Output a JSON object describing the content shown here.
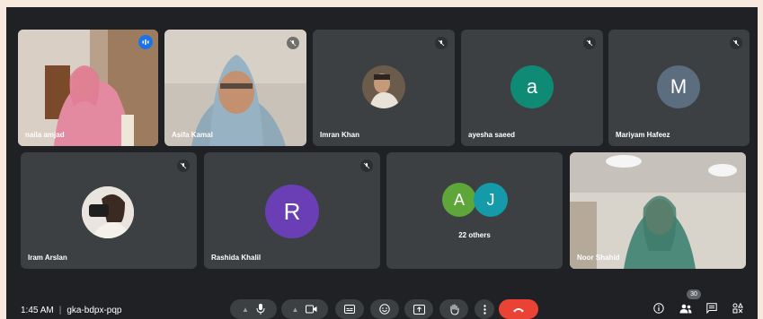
{
  "participants": [
    {
      "name": "naila amjad",
      "speaking": true
    },
    {
      "name": "Asifa Kamal"
    },
    {
      "name": "Imran Khan"
    },
    {
      "name": "ayesha saeed",
      "initial": "a",
      "color": "#0f8a74"
    },
    {
      "name": "Mariyam Hafeez",
      "initial": "M",
      "color": "#5b6d7e"
    },
    {
      "name": "Iram Arslan"
    },
    {
      "name": "Rashida Khalil",
      "initial": "R",
      "color": "#6a3fb6"
    },
    {
      "name": "Noor Shahid"
    }
  ],
  "others": {
    "label": "22 others",
    "initials": [
      "A",
      "J"
    ],
    "colors": [
      "#5ea63a",
      "#149aa8"
    ]
  },
  "meeting": {
    "time": "1:45 AM",
    "separator": "|",
    "code": "gka-bdpx-pqp"
  },
  "people_count": "30",
  "icons": {
    "mic": "mic-icon",
    "camera": "camera-icon",
    "captions": "captions-icon",
    "emoji": "emoji-icon",
    "present": "present-icon",
    "hand": "raise-hand-icon",
    "more": "more-icon",
    "end": "end-call-icon",
    "info": "info-icon",
    "people": "people-icon",
    "chat": "chat-icon",
    "activities": "activities-icon"
  }
}
